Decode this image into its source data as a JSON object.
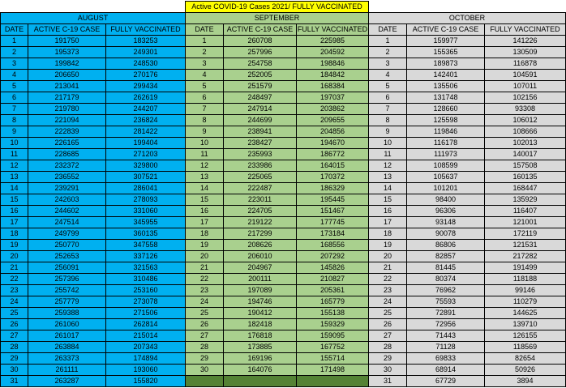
{
  "title": "Active COVID-19 Cases 2021/ FULLY VACCINATED",
  "months": [
    {
      "name": "AUGUST",
      "headers": [
        "DATE",
        "ACTIVE C-19 CASE",
        "FULLY VACCINATED"
      ],
      "rows": [
        [
          "1",
          "191750",
          "183253"
        ],
        [
          "2",
          "195373",
          "249301"
        ],
        [
          "3",
          "199842",
          "248530"
        ],
        [
          "4",
          "206650",
          "270176"
        ],
        [
          "5",
          "213041",
          "299434"
        ],
        [
          "6",
          "217179",
          "262619"
        ],
        [
          "7",
          "219780",
          "244207"
        ],
        [
          "8",
          "221094",
          "236824"
        ],
        [
          "9",
          "222839",
          "281422"
        ],
        [
          "10",
          "226165",
          "199404"
        ],
        [
          "11",
          "228685",
          "271203"
        ],
        [
          "12",
          "232372",
          "329800"
        ],
        [
          "13",
          "236552",
          "307521"
        ],
        [
          "14",
          "239291",
          "286041"
        ],
        [
          "15",
          "242603",
          "278093"
        ],
        [
          "16",
          "244602",
          "331060"
        ],
        [
          "17",
          "247514",
          "345955"
        ],
        [
          "18",
          "249799",
          "360135"
        ],
        [
          "19",
          "250770",
          "347558"
        ],
        [
          "20",
          "252653",
          "337126"
        ],
        [
          "21",
          "256091",
          "321563"
        ],
        [
          "22",
          "257396",
          "310486"
        ],
        [
          "23",
          "255742",
          "253160"
        ],
        [
          "24",
          "257779",
          "273078"
        ],
        [
          "25",
          "259388",
          "271506"
        ],
        [
          "26",
          "261060",
          "262814"
        ],
        [
          "27",
          "261017",
          "215014"
        ],
        [
          "28",
          "263884",
          "207343"
        ],
        [
          "29",
          "263373",
          "174894"
        ],
        [
          "30",
          "261111",
          "193060"
        ],
        [
          "31",
          "263287",
          "155820"
        ]
      ]
    },
    {
      "name": "SEPTEMBER",
      "headers": [
        "DATE",
        "ACTIVE C-19 CASE",
        "FULLY VACCINATED"
      ],
      "rows": [
        [
          "1",
          "260708",
          "225985"
        ],
        [
          "2",
          "257996",
          "204592"
        ],
        [
          "3",
          "254758",
          "198846"
        ],
        [
          "4",
          "252005",
          "184842"
        ],
        [
          "5",
          "251579",
          "168384"
        ],
        [
          "6",
          "248497",
          "197037"
        ],
        [
          "7",
          "247914",
          "203862"
        ],
        [
          "8",
          "244699",
          "209655"
        ],
        [
          "9",
          "238941",
          "204856"
        ],
        [
          "10",
          "238427",
          "194670"
        ],
        [
          "11",
          "235993",
          "186772"
        ],
        [
          "12",
          "233986",
          "164015"
        ],
        [
          "13",
          "225065",
          "170372"
        ],
        [
          "14",
          "222487",
          "186329"
        ],
        [
          "15",
          "223011",
          "195445"
        ],
        [
          "16",
          "224705",
          "151467"
        ],
        [
          "17",
          "219122",
          "177745"
        ],
        [
          "18",
          "217299",
          "173184"
        ],
        [
          "19",
          "208626",
          "168556"
        ],
        [
          "20",
          "206010",
          "207292"
        ],
        [
          "21",
          "204967",
          "145826"
        ],
        [
          "22",
          "200111",
          "210827"
        ],
        [
          "23",
          "197089",
          "205361"
        ],
        [
          "24",
          "194746",
          "165779"
        ],
        [
          "25",
          "190412",
          "155138"
        ],
        [
          "26",
          "182418",
          "159329"
        ],
        [
          "27",
          "176818",
          "159095"
        ],
        [
          "28",
          "173885",
          "167752"
        ],
        [
          "29",
          "169196",
          "155714"
        ],
        [
          "30",
          "164076",
          "171498"
        ],
        [
          "",
          "",
          ""
        ]
      ]
    },
    {
      "name": "OCTOBER",
      "headers": [
        "DATE",
        "ACTIVE C-19 CASE",
        "FULLY VACCINATED"
      ],
      "rows": [
        [
          "1",
          "159977",
          "141226"
        ],
        [
          "2",
          "155365",
          "130509"
        ],
        [
          "3",
          "189873",
          "116878"
        ],
        [
          "4",
          "142401",
          "104591"
        ],
        [
          "5",
          "135506",
          "107011"
        ],
        [
          "6",
          "131748",
          "102156"
        ],
        [
          "7",
          "128660",
          "93308"
        ],
        [
          "8",
          "125598",
          "106012"
        ],
        [
          "9",
          "119846",
          "108666"
        ],
        [
          "10",
          "116178",
          "102013"
        ],
        [
          "11",
          "111973",
          "140017"
        ],
        [
          "12",
          "108599",
          "157508"
        ],
        [
          "13",
          "105637",
          "160135"
        ],
        [
          "14",
          "101201",
          "168447"
        ],
        [
          "15",
          "98400",
          "135929"
        ],
        [
          "16",
          "96306",
          "116407"
        ],
        [
          "17",
          "93148",
          "121001"
        ],
        [
          "18",
          "90078",
          "172119"
        ],
        [
          "19",
          "86806",
          "121531"
        ],
        [
          "20",
          "82857",
          "217282"
        ],
        [
          "21",
          "81445",
          "191499"
        ],
        [
          "22",
          "80374",
          "118188"
        ],
        [
          "23",
          "76962",
          "99146"
        ],
        [
          "24",
          "75593",
          "110279"
        ],
        [
          "25",
          "72891",
          "144625"
        ],
        [
          "26",
          "72956",
          "139710"
        ],
        [
          "27",
          "71443",
          "126155"
        ],
        [
          "28",
          "71128",
          "118569"
        ],
        [
          "29",
          "69833",
          "82654"
        ],
        [
          "30",
          "68914",
          "50926"
        ],
        [
          "31",
          "67729",
          "3894"
        ]
      ]
    }
  ],
  "colors": {
    "title_bg": "#ffff00",
    "august_bg": "#00b0f0",
    "september_bg": "#a9d08e",
    "september_empty_bg": "#548235",
    "october_bg": "#d9d9d9"
  }
}
